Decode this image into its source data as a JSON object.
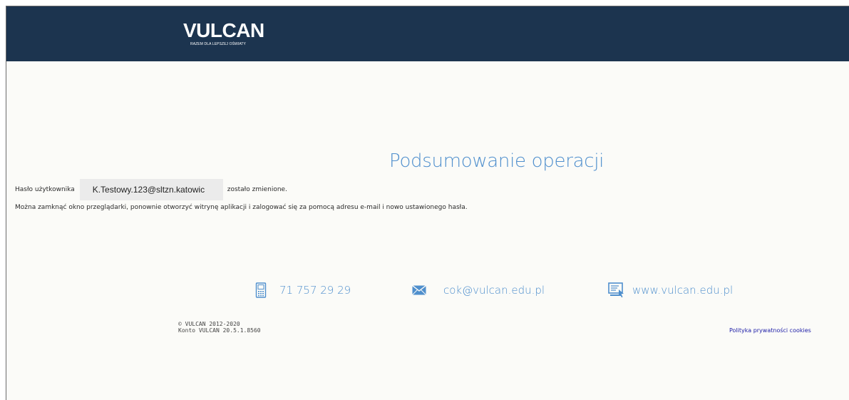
{
  "header": {
    "logo_text": "VULCAN",
    "logo_tagline": "RAZEM DLA LEPSZEJ OŚWIATY"
  },
  "main": {
    "title": "Podsumowanie operacji",
    "password_label": "Hasło użytkownika",
    "user_login": "K.Testowy.123@sltzn.katowic",
    "changed_text": "zostało zmienione.",
    "info_text": "Można zamknąć okno przeglądarki, ponownie otworzyć witrynę aplikacji i zalogować się za pomocą adresu e-mail i nowo ustawionego hasła."
  },
  "contact": {
    "phone": "71 757 29 29",
    "email": "cok@vulcan.edu.pl",
    "website": "www.vulcan.edu.pl",
    "phone_icon": "phone-icon",
    "email_icon": "envelope-icon",
    "website_icon": "monitor-icon"
  },
  "footer": {
    "copyright": "© VULCAN 2012-2020",
    "version": "Konto VULCAN 20.5.1.8560",
    "cookie_link": "Polityka prywatności cookies"
  },
  "colors": {
    "header_bg": "#1c344f",
    "accent": "#4f8fcd",
    "page_bg": "#fbfbf8",
    "link": "#1a1aa6"
  }
}
